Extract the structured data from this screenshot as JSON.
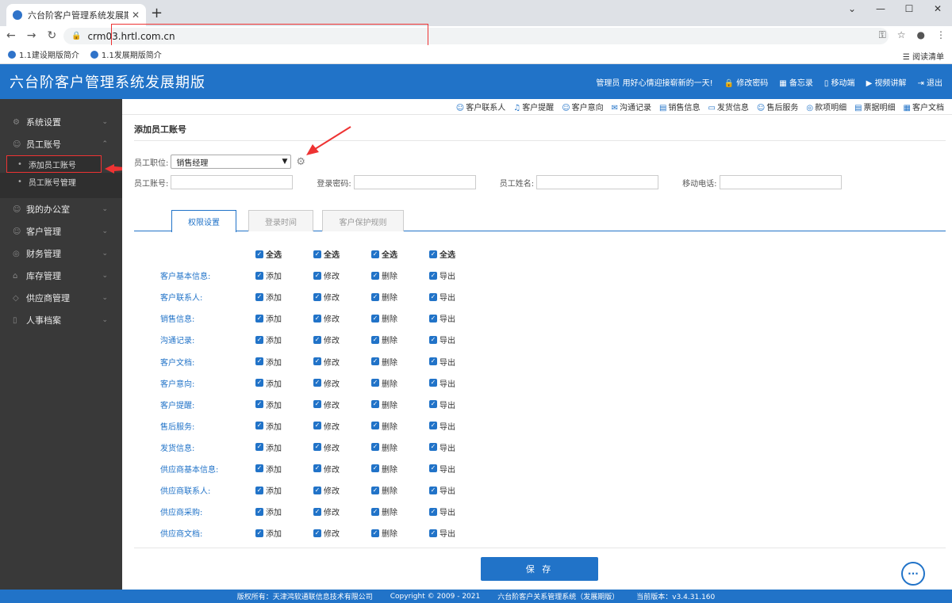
{
  "browser": {
    "tab_title": "六台阶客户管理系统发展期版",
    "url": "crm03.hrtl.com.cn",
    "bookmarks": [
      "1.1建设期版简介",
      "1.1发展期版简介"
    ],
    "reading_list": "阅读清单"
  },
  "header": {
    "title": "六台阶客户管理系统发展期版",
    "greeting": "管理员 用好心情迎接崭新的一天!",
    "links": [
      "修改密码",
      "备忘录",
      "移动端",
      "视频讲解",
      "退出"
    ]
  },
  "sidebar": {
    "items": [
      {
        "label": "系统设置",
        "icon": "gear-icon"
      },
      {
        "label": "员工账号",
        "icon": "users-icon"
      },
      {
        "label": "我的办公室",
        "icon": "office-icon"
      },
      {
        "label": "客户管理",
        "icon": "customer-icon"
      },
      {
        "label": "财务管理",
        "icon": "finance-icon"
      },
      {
        "label": "库存管理",
        "icon": "inventory-icon"
      },
      {
        "label": "供应商管理",
        "icon": "supplier-icon"
      },
      {
        "label": "人事档案",
        "icon": "hr-icon"
      }
    ],
    "subitems": [
      "添加员工账号",
      "员工账号管理"
    ]
  },
  "toptabs": [
    "客户联系人",
    "客户提醒",
    "客户意向",
    "沟通记录",
    "销售信息",
    "发货信息",
    "售后服务",
    "款项明细",
    "票据明细",
    "客户文档"
  ],
  "form": {
    "page_title": "添加员工账号",
    "position_label": "员工职位:",
    "position_value": "销售经理",
    "account_label": "员工账号:",
    "password_label": "登录密码:",
    "name_label": "员工姓名:",
    "phone_label": "移动电话:"
  },
  "tabs": [
    "权限设置",
    "登录时间",
    "客户保护规则"
  ],
  "permissions": {
    "select_all": "全选",
    "actions": [
      "添加",
      "修改",
      "删除",
      "导出"
    ],
    "rows": [
      "客户基本信息:",
      "客户联系人:",
      "销售信息:",
      "沟通记录:",
      "客户文档:",
      "客户意向:",
      "客户提醒:",
      "售后服务:",
      "发货信息:",
      "供应商基本信息:",
      "供应商联系人:",
      "供应商采购:",
      "供应商文档:"
    ]
  },
  "save_label": "保 存",
  "footer": {
    "copyright_owner": "版权所有：天津鸿软通联信息技术有限公司",
    "copyright": "Copyright © 2009 - 2021",
    "system": "六台阶客户关系管理系统（发展期版）",
    "version": "当前版本：v3.4.31.160"
  }
}
